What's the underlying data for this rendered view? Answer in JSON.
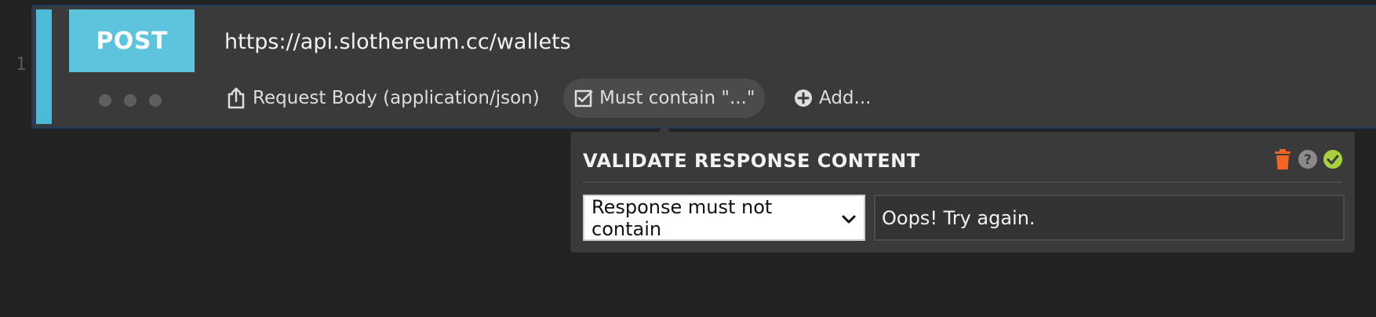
{
  "editor": {
    "line_number": "1"
  },
  "request": {
    "method": "POST",
    "url": "https://api.slothereum.cc/wallets",
    "actions": {
      "body_label": "Request Body (application/json)",
      "contain_label": "Must contain \"...\"",
      "add_label": "Add..."
    }
  },
  "popover": {
    "title": "VALIDATE RESPONSE CONTENT",
    "select": {
      "selected": "Response must not contain"
    },
    "input": {
      "value": "Oops! Try again."
    }
  },
  "colors": {
    "accent": "#5ec3dc",
    "delete": "#f26522",
    "help": "#8a8a8a",
    "confirm": "#a6d13b"
  },
  "icons": [
    "upload-icon",
    "checkbox-icon",
    "plus-circle-icon",
    "trash-icon",
    "help-icon",
    "check-circle-icon",
    "chevron-down-icon"
  ]
}
